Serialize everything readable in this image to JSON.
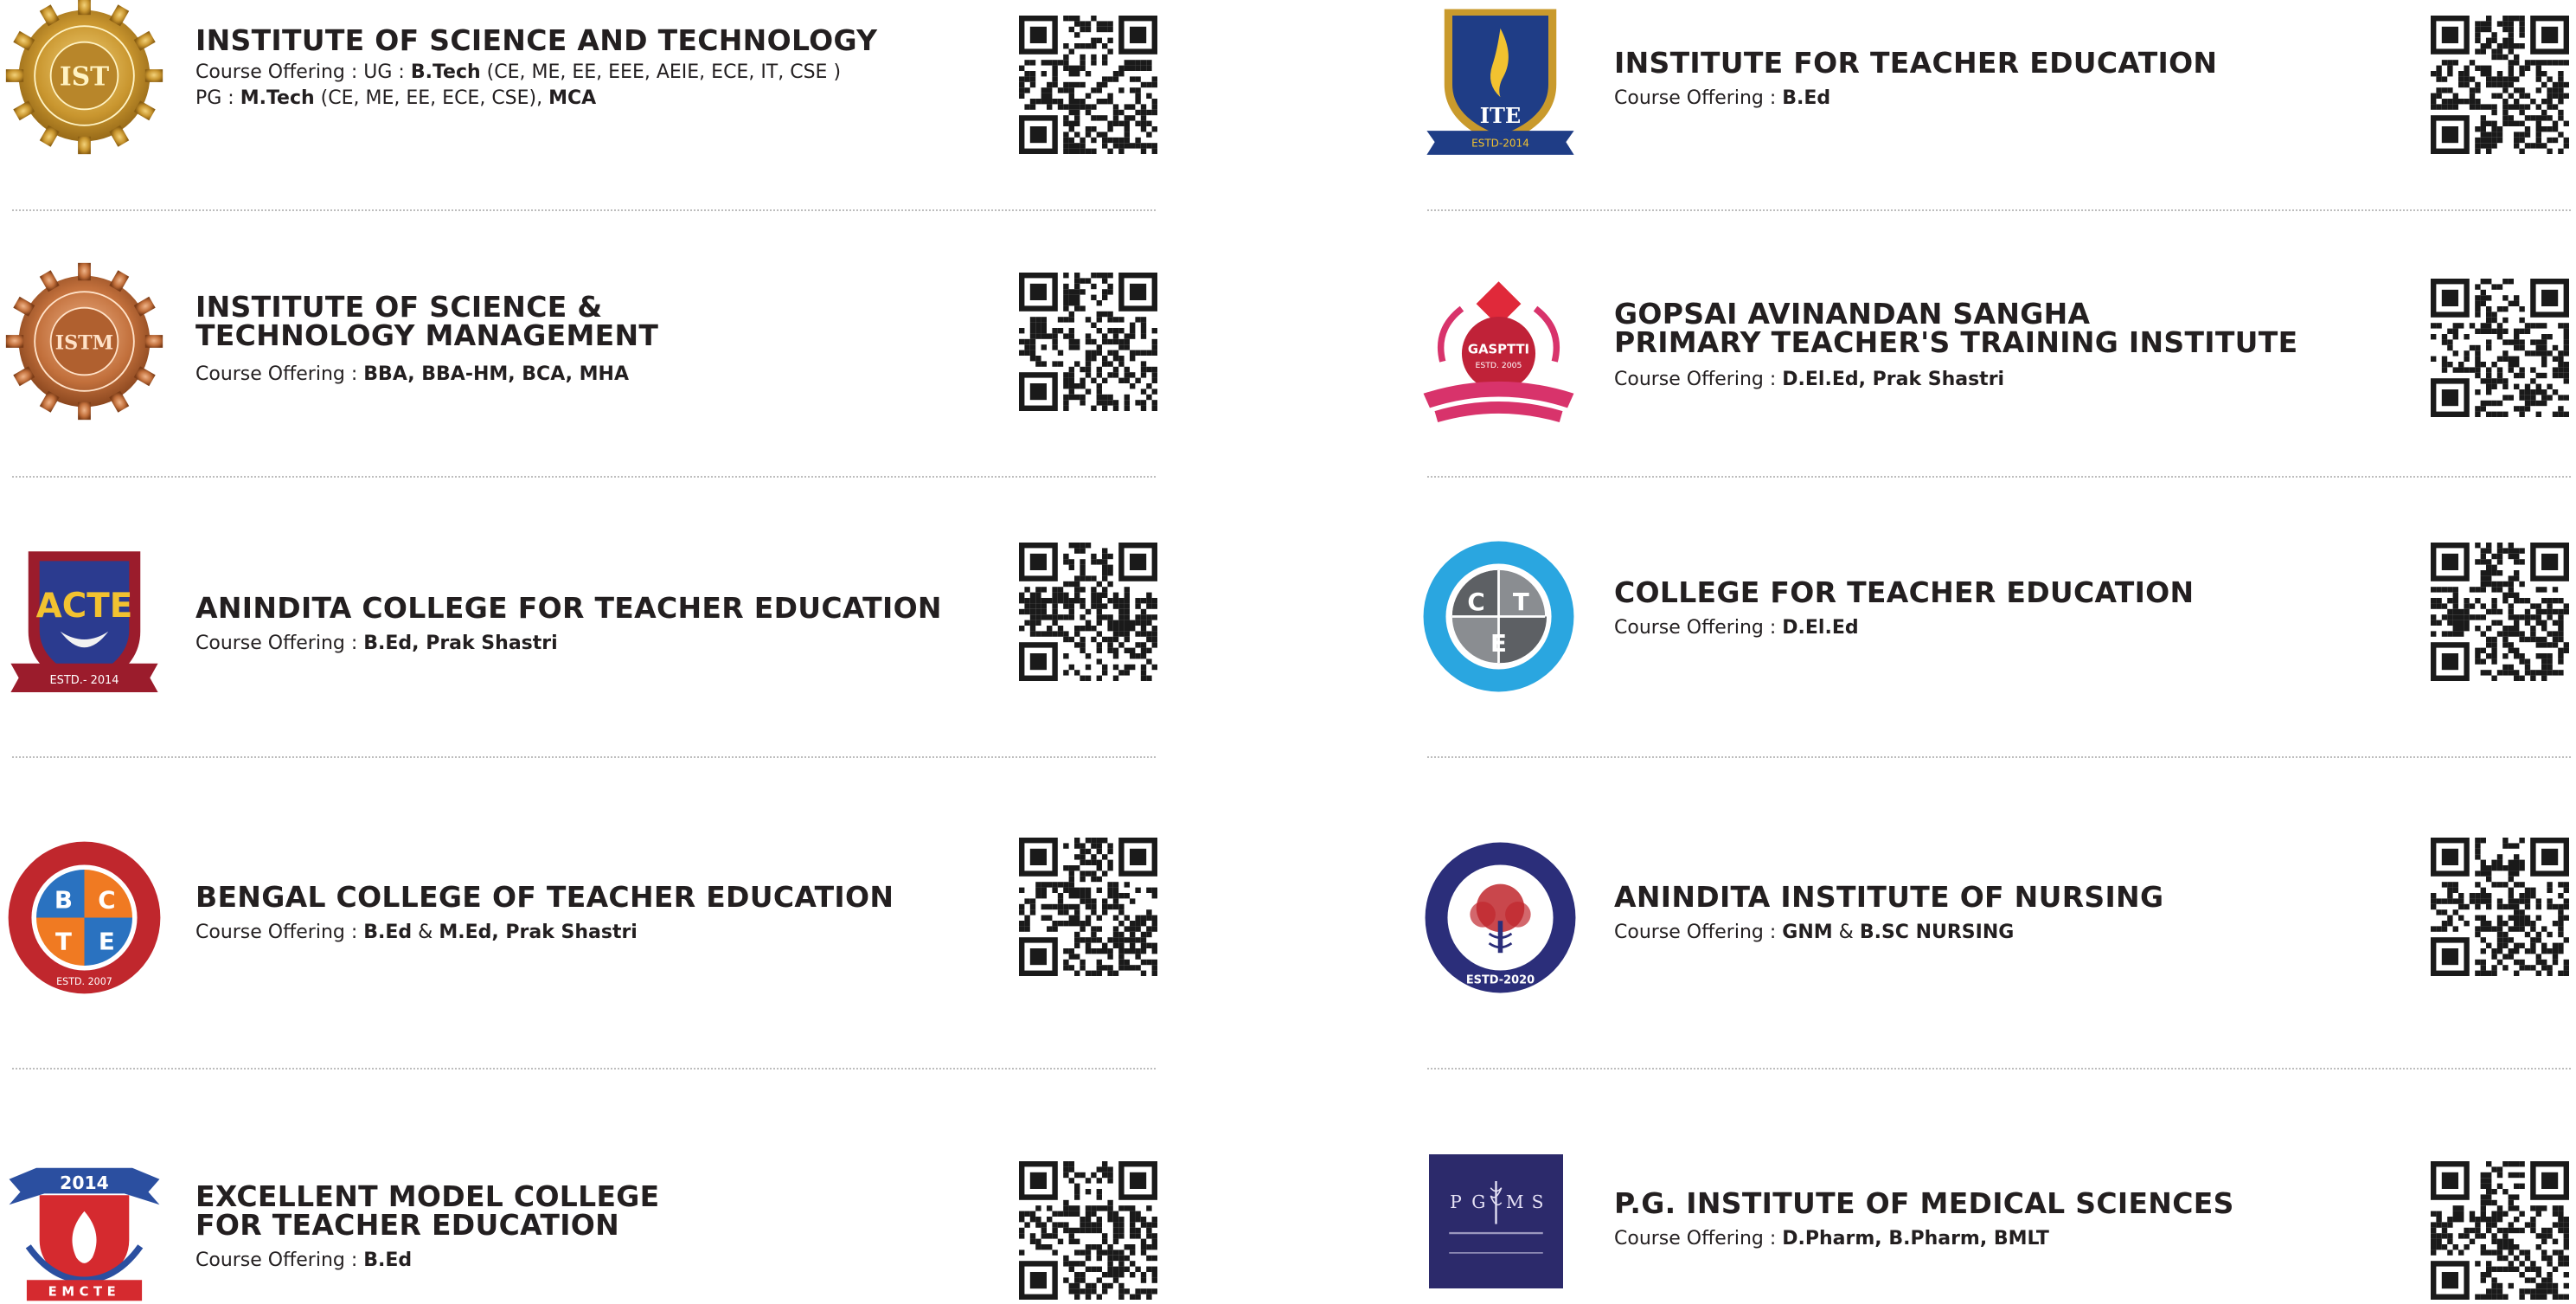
{
  "colors": {
    "title": "#231f20",
    "divider": "#bdbdbd",
    "qr": "#1a1a1a"
  },
  "left": [
    {
      "name": "INSTITUTE OF SCIENCE AND TECHNOLOGY",
      "logo": "ist-gear-gold-logo",
      "logo_text": "IST",
      "line1_label": "Course Offering : UG : ",
      "line1_bold": "B.Tech",
      "line1_rest": " (CE, ME, EE, EEE, AEIE, ECE, IT, CSE )",
      "line2_label": "PG : ",
      "line2_bold": "M.Tech",
      "line2_rest": " (CE, ME, EE, ECE, CSE), ",
      "line2_bold2": "MCA"
    },
    {
      "name1": "INSTITUTE OF SCIENCE &",
      "name2": "TECHNOLOGY MANAGEMENT",
      "logo": "istm-gear-bronze-logo",
      "logo_text": "ISTM",
      "label": "Course Offering : ",
      "value": "BBA, BBA-HM, BCA, MHA"
    },
    {
      "name": "ANINDITA COLLEGE FOR TEACHER EDUCATION",
      "logo": "acte-shield-logo",
      "logo_text": "ACTE",
      "logo_estd": "ESTD.- 2014",
      "label": "Course Offering : ",
      "value": "B.Ed, Prak Shastri"
    },
    {
      "name": "BENGAL COLLEGE OF TEACHER EDUCATION",
      "logo": "bcte-circle-logo",
      "logo_letters": [
        "B",
        "C",
        "T",
        "E"
      ],
      "logo_estd": "ESTD. 2007",
      "label": "Course Offering : ",
      "value1": "B.Ed",
      "amp": " & ",
      "value2": "M.Ed, Prak Shastri"
    },
    {
      "name1": "EXCELLENT MODEL COLLEGE",
      "name2": "FOR TEACHER EDUCATION",
      "logo": "emcte-shield-logo",
      "logo_year": "2014",
      "logo_text": "EMCTE",
      "label": "Course Offering : ",
      "value": "B.Ed"
    }
  ],
  "right": [
    {
      "name": "INSTITUTE FOR TEACHER EDUCATION",
      "logo": "ite-shield-logo",
      "logo_text": "ITE",
      "logo_estd": "ESTD-2014",
      "label": "Course Offering : ",
      "value": "B.Ed"
    },
    {
      "name1": "GOPSAI AVINANDAN SANGHA",
      "name2": "PRIMARY TEACHER'S TRAINING INSTITUTE",
      "logo": "gasptti-logo",
      "logo_text": "GASPTTI",
      "logo_estd": "ESTD. 2005",
      "label": "Course Offering : ",
      "value": "D.El.Ed, Prak Shastri"
    },
    {
      "name": "COLLEGE FOR TEACHER EDUCATION",
      "logo": "cte-circle-logo",
      "logo_letters": [
        "C",
        "T",
        "E"
      ],
      "label": "Course Offering : ",
      "value": "D.El.Ed"
    },
    {
      "name": "ANINDITA INSTITUTE OF NURSING",
      "logo": "ain-circle-logo",
      "logo_estd": "ESTD-2020",
      "label": "Course Offering : ",
      "value1": "GNM",
      "amp": " & ",
      "value2": "B.SC NURSING"
    },
    {
      "name": "P.G. INSTITUTE OF MEDICAL SCIENCES",
      "logo": "pgims-square-logo",
      "logo_letters": [
        "P",
        "G",
        "M",
        "S"
      ],
      "label": "Course Offering : ",
      "value": "D.Pharm, B.Pharm, BMLT"
    }
  ]
}
